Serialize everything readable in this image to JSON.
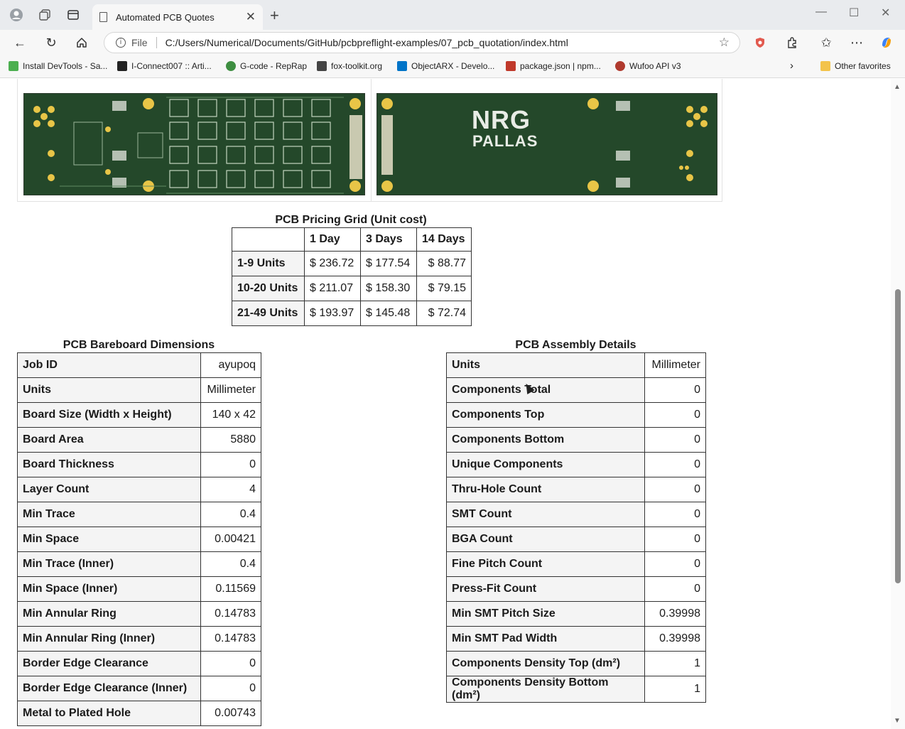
{
  "browser": {
    "tab_title": "Automated PCB Quotes",
    "file_label": "File",
    "url": "C:/Users/Numerical/Documents/GitHub/pcbpreflight-examples/07_pcb_quotation/index.html",
    "bookmarks": [
      {
        "label": "Install DevTools - Sa...",
        "color": "#4caf50"
      },
      {
        "label": "I-Connect007 :: Arti...",
        "color": "#222222"
      },
      {
        "label": "G-code - RepRap",
        "color": "#3e8e41"
      },
      {
        "label": "fox-toolkit.org",
        "color": "#444444"
      },
      {
        "label": "ObjectARX - Develo...",
        "color": "#0074c8"
      },
      {
        "label": "package.json | npm...",
        "color": "#c0392b"
      },
      {
        "label": "Wufoo API v3",
        "color": "#b03a2e"
      }
    ],
    "other_favorites": "Other favorites"
  },
  "pcb_images": {
    "back_logo_line1": "NRG",
    "back_logo_line2": "PALLAS"
  },
  "pricing": {
    "caption": "PCB Pricing Grid (Unit cost)",
    "headers": [
      "1 Day",
      "3 Days",
      "14 Days"
    ],
    "rows": [
      {
        "label": "1-9 Units",
        "values": [
          "$ 236.72",
          "$ 177.54",
          "$ 88.77"
        ]
      },
      {
        "label": "10-20 Units",
        "values": [
          "$ 211.07",
          "$ 158.30",
          "$ 79.15"
        ]
      },
      {
        "label": "21-49 Units",
        "values": [
          "$ 193.97",
          "$ 145.48",
          "$ 72.74"
        ]
      }
    ]
  },
  "bareboard": {
    "caption": "PCB Bareboard Dimensions",
    "rows": [
      {
        "label": "Job ID",
        "value": "ayupoq"
      },
      {
        "label": "Units",
        "value": "Millimeter"
      },
      {
        "label": "Board Size (Width x Height)",
        "value": "140 x 42"
      },
      {
        "label": "Board Area",
        "value": "5880"
      },
      {
        "label": "Board Thickness",
        "value": "0"
      },
      {
        "label": "Layer Count",
        "value": "4"
      },
      {
        "label": "Min Trace",
        "value": "0.4"
      },
      {
        "label": "Min Space",
        "value": "0.00421"
      },
      {
        "label": "Min Trace (Inner)",
        "value": "0.4"
      },
      {
        "label": "Min Space (Inner)",
        "value": "0.11569"
      },
      {
        "label": "Min Annular Ring",
        "value": "0.14783"
      },
      {
        "label": "Min Annular Ring (Inner)",
        "value": "0.14783"
      },
      {
        "label": "Border Edge Clearance",
        "value": "0"
      },
      {
        "label": "Border Edge Clearance (Inner)",
        "value": "0"
      },
      {
        "label": "Metal to Plated Hole",
        "value": "0.00743"
      }
    ]
  },
  "assembly": {
    "caption": "PCB Assembly Details",
    "rows": [
      {
        "label": "Units",
        "value": "Millimeter"
      },
      {
        "label": "Components Total",
        "value": "0"
      },
      {
        "label": "Components Top",
        "value": "0"
      },
      {
        "label": "Components Bottom",
        "value": "0"
      },
      {
        "label": "Unique Components",
        "value": "0"
      },
      {
        "label": "Thru-Hole Count",
        "value": "0"
      },
      {
        "label": "SMT Count",
        "value": "0"
      },
      {
        "label": "BGA Count",
        "value": "0"
      },
      {
        "label": "Fine Pitch Count",
        "value": "0"
      },
      {
        "label": "Press-Fit Count",
        "value": "0"
      },
      {
        "label": "Min SMT Pitch Size",
        "value": "0.39998"
      },
      {
        "label": "Min SMT Pad Width",
        "value": "0.39998"
      },
      {
        "label": "Components Density Top (dm²)",
        "value": "1"
      },
      {
        "label": "Components Density Bottom (dm²)",
        "value": "1"
      }
    ]
  }
}
